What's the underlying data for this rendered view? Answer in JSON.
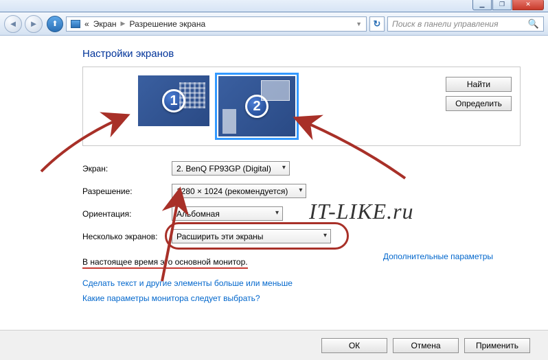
{
  "window_controls": {
    "min": "▁",
    "max": "❐",
    "close": "✕"
  },
  "nav": {
    "crumb_prefix": "«",
    "crumb1": "Экран",
    "crumb2": "Разрешение экрана",
    "search_placeholder": "Поиск в панели управления"
  },
  "heading": "Настройки экранов",
  "monitors": [
    {
      "id": 1,
      "num": "1",
      "selected": false
    },
    {
      "id": 2,
      "num": "2",
      "selected": true
    }
  ],
  "panel_buttons": {
    "find": "Найти",
    "detect": "Определить"
  },
  "form": {
    "screen_label": "Экран:",
    "screen_value": "2. BenQ FP93GP (Digital)",
    "resolution_label": "Разрешение:",
    "resolution_value": "1280 × 1024 (рекомендуется)",
    "orientation_label": "Ориентация:",
    "orientation_value": "Альбомная",
    "multi_label": "Несколько экранов:",
    "multi_value": "Расширить эти экраны"
  },
  "status_text": "В настоящее время это основной монитор.",
  "extra_link": "Дополнительные параметры",
  "help_links": [
    "Сделать текст и другие элементы больше или меньше",
    "Какие параметры монитора следует выбрать?"
  ],
  "footer": {
    "ok": "ОК",
    "cancel": "Отмена",
    "apply": "Применить"
  },
  "watermark": "IT-LIKE.ru"
}
